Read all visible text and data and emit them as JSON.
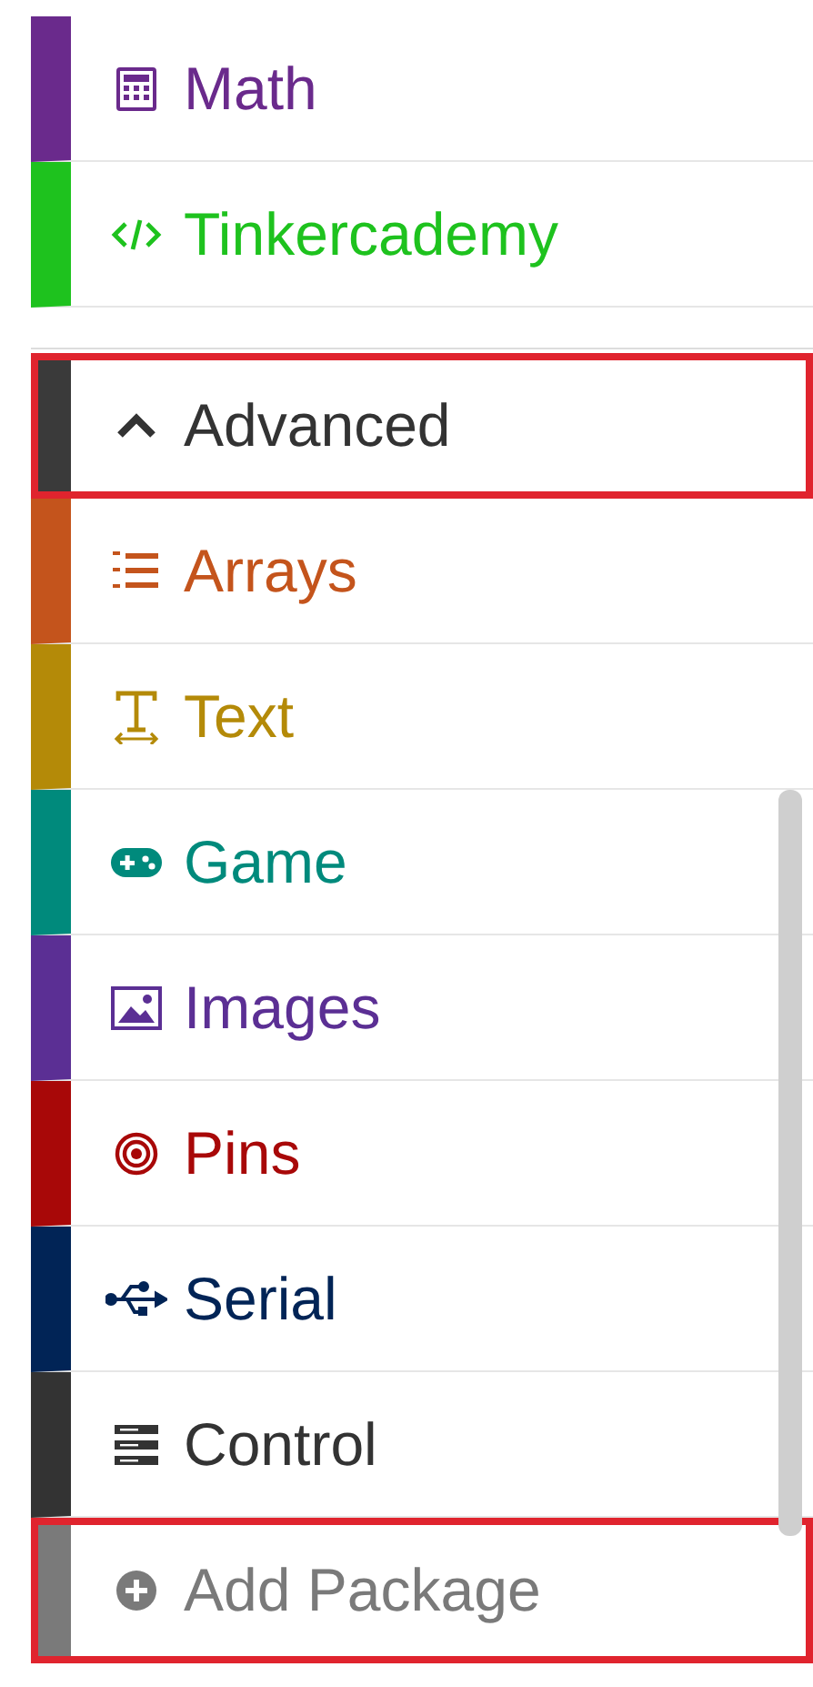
{
  "toolbox": {
    "groups": [
      {
        "items": [
          {
            "kind": "math",
            "label": "Math",
            "color": "#6a2a8c",
            "highlighted": false
          },
          {
            "kind": "extension",
            "label": "Tinkercademy",
            "color": "#1ec21e",
            "highlighted": false
          }
        ]
      },
      {
        "items": [
          {
            "kind": "toggle",
            "label": "Advanced",
            "color": "#3a3a3a",
            "highlighted": true,
            "expanded": true
          },
          {
            "kind": "arrays",
            "label": "Arrays",
            "color": "#c4541c",
            "highlighted": false
          },
          {
            "kind": "text",
            "label": "Text",
            "color": "#b48a08",
            "highlighted": false
          },
          {
            "kind": "game",
            "label": "Game",
            "color": "#008a7c",
            "highlighted": false
          },
          {
            "kind": "images",
            "label": "Images",
            "color": "#5b2f94",
            "highlighted": false
          },
          {
            "kind": "pins",
            "label": "Pins",
            "color": "#a80808",
            "highlighted": false
          },
          {
            "kind": "serial",
            "label": "Serial",
            "color": "#012456",
            "highlighted": false
          },
          {
            "kind": "control",
            "label": "Control",
            "color": "#333333",
            "highlighted": false
          },
          {
            "kind": "add",
            "label": "Add Package",
            "color": "#7a7a7a",
            "highlighted": true
          }
        ]
      }
    ]
  }
}
